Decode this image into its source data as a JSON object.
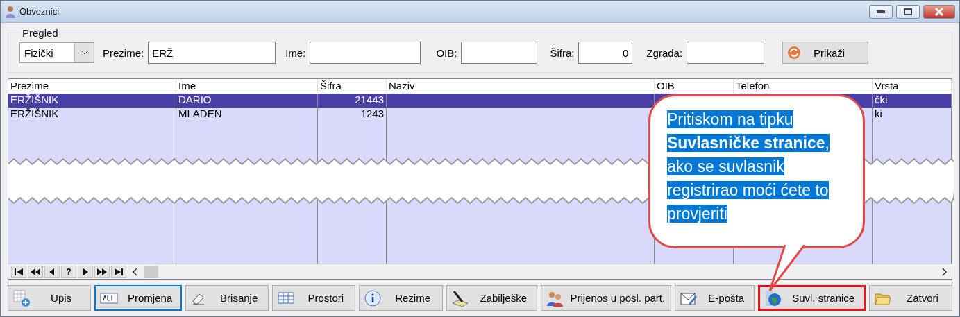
{
  "window": {
    "title": "Obveznici"
  },
  "filter": {
    "legend": "Pregled",
    "type_value": "Fizički",
    "show_button": "Prikaži",
    "fields": [
      {
        "label": "Prezime:",
        "value": "ERŽ",
        "kind": "text"
      },
      {
        "label": "Ime:",
        "kind": "text"
      },
      {
        "label": "OIB:",
        "kind": "text"
      },
      {
        "label": "Šifra:",
        "value": "0",
        "kind": "number"
      },
      {
        "label": "Zgrada:",
        "kind": "text"
      }
    ]
  },
  "table": {
    "columns": [
      {
        "label": "Prezime",
        "kind": "text"
      },
      {
        "label": "Ime",
        "kind": "text"
      },
      {
        "label": "Šifra",
        "kind": "number"
      },
      {
        "label": "Naziv",
        "kind": "text"
      },
      {
        "label": "OIB",
        "kind": "text"
      },
      {
        "label": "Telefon",
        "kind": "text"
      },
      {
        "label": "Vrsta",
        "kind": "text"
      }
    ],
    "rows": [
      {
        "selected": true,
        "cells": [
          "ERŽIŠNIK",
          "DARIO",
          "21443",
          null,
          null,
          null,
          "čki"
        ]
      },
      {
        "selected": false,
        "cells": [
          "ERŽIŠNIK",
          "MLADEN",
          "1243",
          null,
          null,
          null,
          "ki"
        ]
      }
    ]
  },
  "record_nav": {
    "help": "?"
  },
  "buttons": [
    {
      "label": "Upis",
      "kind": "add",
      "focused": false,
      "highlighted": false
    },
    {
      "label": "Promjena",
      "kind": "edit",
      "focused": true,
      "highlighted": false
    },
    {
      "label": "Brisanje",
      "kind": "erase",
      "focused": false,
      "highlighted": false
    },
    {
      "label": "Prostori",
      "kind": "grid",
      "focused": false,
      "highlighted": false
    },
    {
      "label": "Rezime",
      "kind": "info",
      "focused": false,
      "highlighted": false
    },
    {
      "label": "Zabilješke",
      "kind": "note",
      "focused": false,
      "highlighted": false
    },
    {
      "label": "Prijenos u posl. part.",
      "kind": "people",
      "focused": false,
      "highlighted": false
    },
    {
      "label": "E-pošta",
      "kind": "mail",
      "focused": false,
      "highlighted": false
    },
    {
      "label": "Suvl. stranice",
      "kind": "globe",
      "focused": false,
      "highlighted": true
    },
    {
      "label": "Zatvori",
      "kind": "folder",
      "focused": false,
      "highlighted": false
    }
  ],
  "callout": {
    "text": "Pritiskom na tipku **Suvlasničke stranice**, ako se suvlasnik registrirao moći ćete to provjeriti"
  }
}
